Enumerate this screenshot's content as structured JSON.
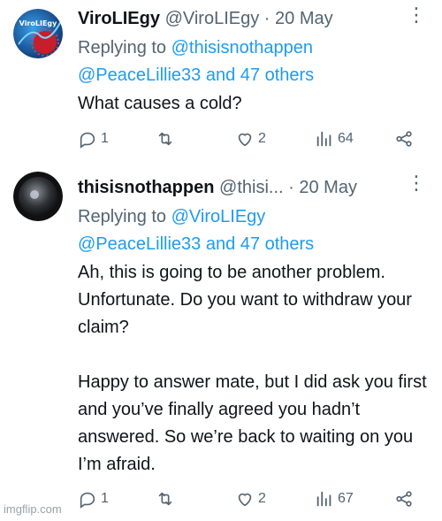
{
  "tweets": [
    {
      "name": "ViroLIEgy",
      "handle": "@ViroLIEgy",
      "separator": "·",
      "date": "20 May",
      "replying_prefix": "Replying to",
      "replying_line1_mention": "@thisisnothappen",
      "replying_line2_mention": "@PeaceLillie33",
      "replying_line2_suffix": "and 47 others",
      "text": [
        "What causes a cold?"
      ],
      "reply_count": "1",
      "like_count": "2",
      "view_count": "64",
      "avatar_text": "ViroLIEgy"
    },
    {
      "name": "thisisnothappen",
      "handle": "@thisi...",
      "separator": "·",
      "date": "20 May",
      "replying_prefix": "Replying to",
      "replying_line1_mention": "@ViroLIEgy",
      "replying_line2_mention": "@PeaceLillie33",
      "replying_line2_suffix": "and 47 others",
      "text": [
        "Ah, this is going to be another problem. Unfortunate. Do you want to withdraw your claim?",
        "Happy to answer mate, but I did ask you first and you’ve finally agreed you hadn’t answered. So we’re back to waiting on you I’m afraid."
      ],
      "reply_count": "1",
      "like_count": "2",
      "view_count": "67"
    }
  ],
  "more_glyph": "⋮",
  "watermark": "imgflip.com",
  "colors": {
    "text": "#0f1419",
    "muted": "#536471",
    "link": "#1d9bf0"
  }
}
